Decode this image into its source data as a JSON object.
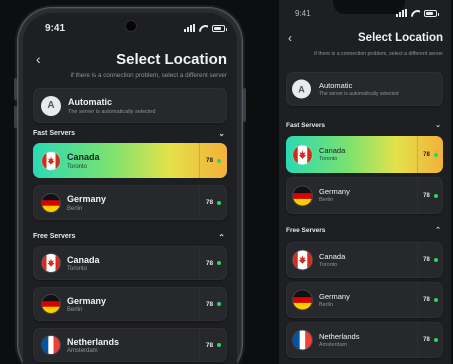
{
  "status": {
    "time": "9:41",
    "icons": [
      "signal-icon",
      "wifi-icon",
      "battery-icon"
    ]
  },
  "header": {
    "back_icon": "chevron-left-icon",
    "title": "Select Location",
    "subtitle": "if there is a connection problem, select a different server"
  },
  "automatic": {
    "badge": "A",
    "name": "Automatic",
    "description": "The server is automatically selected"
  },
  "fast_servers": {
    "label": "Fast Servers",
    "toggle_icon": "chevron-down-icon",
    "items": [
      {
        "country": "Canada",
        "city": "Toronto",
        "ping": "78",
        "flag": "canada-flag-icon",
        "selected": true
      },
      {
        "country": "Germany",
        "city": "Berlin",
        "ping": "78",
        "flag": "germany-flag-icon",
        "selected": false
      }
    ]
  },
  "free_servers": {
    "label": "Free Servers",
    "toggle_icon": "chevron-up-icon",
    "items": [
      {
        "country": "Canada",
        "city": "Toronto",
        "ping": "78",
        "flag": "canada-flag-icon"
      },
      {
        "country": "Germany",
        "city": "Berlin",
        "ping": "78",
        "flag": "germany-flag-icon"
      },
      {
        "country": "Netherlands",
        "city": "Amsterdam",
        "ping": "78",
        "flag": "france-flag-icon"
      }
    ]
  },
  "colors": {
    "background": "#1e1f23",
    "card": "#26282c",
    "selected_gradient": [
      "#2bd9b3",
      "#7be26e",
      "#e3e24a",
      "#f3b139"
    ],
    "online_dot": "#2fd36a"
  }
}
